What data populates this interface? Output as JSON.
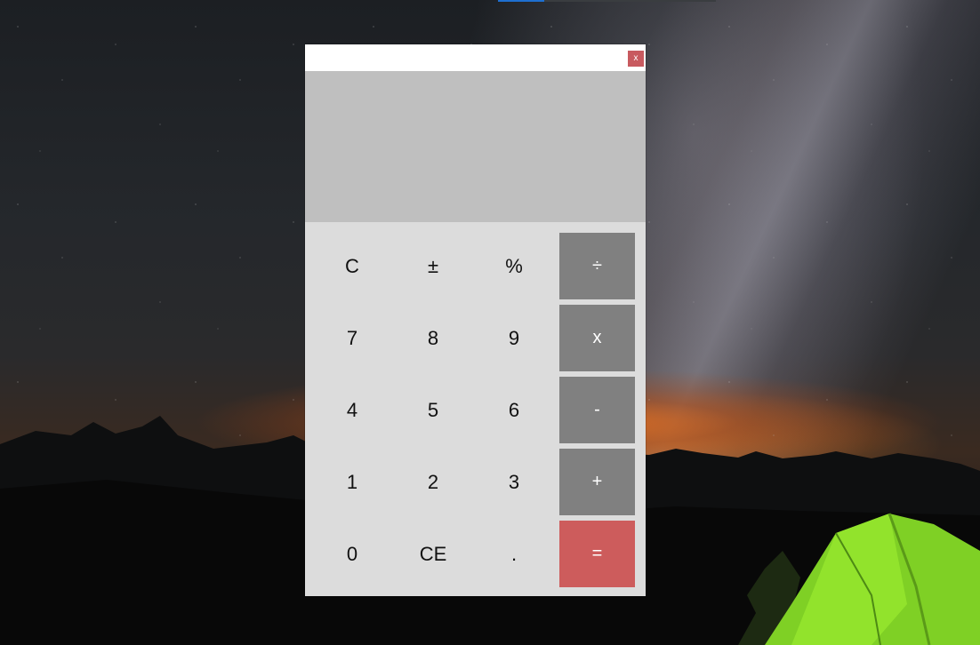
{
  "window": {
    "close_label": "x",
    "display_value": ""
  },
  "keypad": {
    "keys": [
      {
        "label": "C",
        "kind": "function",
        "name": "clear-button"
      },
      {
        "label": "±",
        "kind": "function",
        "name": "negate-button"
      },
      {
        "label": "%",
        "kind": "function",
        "name": "percent-button"
      },
      {
        "label": "÷",
        "kind": "operator",
        "name": "divide-button"
      },
      {
        "label": "7",
        "kind": "digit",
        "name": "digit-7-button"
      },
      {
        "label": "8",
        "kind": "digit",
        "name": "digit-8-button"
      },
      {
        "label": "9",
        "kind": "digit",
        "name": "digit-9-button"
      },
      {
        "label": "x",
        "kind": "operator",
        "name": "multiply-button"
      },
      {
        "label": "4",
        "kind": "digit",
        "name": "digit-4-button"
      },
      {
        "label": "5",
        "kind": "digit",
        "name": "digit-5-button"
      },
      {
        "label": "6",
        "kind": "digit",
        "name": "digit-6-button"
      },
      {
        "label": "-",
        "kind": "operator",
        "name": "subtract-button"
      },
      {
        "label": "1",
        "kind": "digit",
        "name": "digit-1-button"
      },
      {
        "label": "2",
        "kind": "digit",
        "name": "digit-2-button"
      },
      {
        "label": "3",
        "kind": "digit",
        "name": "digit-3-button"
      },
      {
        "label": "+",
        "kind": "operator",
        "name": "add-button"
      },
      {
        "label": "0",
        "kind": "digit",
        "name": "digit-0-button"
      },
      {
        "label": "CE",
        "kind": "function",
        "name": "clear-entry-button"
      },
      {
        "label": ".",
        "kind": "function",
        "name": "decimal-button"
      },
      {
        "label": "=",
        "kind": "equals",
        "name": "equals-button"
      }
    ]
  },
  "colors": {
    "titlebar": "#ffffff",
    "display_bg": "#bfbfbf",
    "keypad_bg": "#dcdcdc",
    "operator_key": "#808080",
    "equals_key": "#cd5c5c",
    "close_button": "#c85a5f"
  }
}
